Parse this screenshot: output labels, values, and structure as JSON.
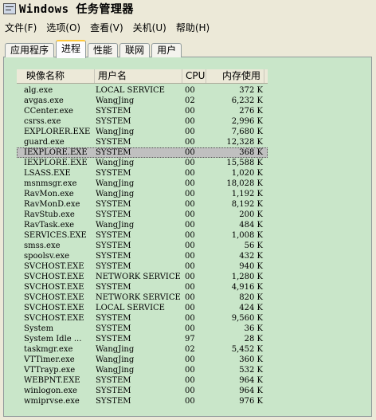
{
  "window": {
    "title": "Windows 任务管理器",
    "icon": "taskmgr-icon"
  },
  "menu": [
    "文件(F)",
    "选项(O)",
    "查看(V)",
    "关机(U)",
    "帮助(H)"
  ],
  "tabs": [
    {
      "label": "应用程序",
      "active": false
    },
    {
      "label": "进程",
      "active": true
    },
    {
      "label": "性能",
      "active": false
    },
    {
      "label": "联网",
      "active": false
    },
    {
      "label": "用户",
      "active": false
    }
  ],
  "columns": [
    "映像名称",
    "用户名",
    "CPU",
    "内存使用"
  ],
  "processes": [
    {
      "name": "alg.exe",
      "user": "LOCAL SERVICE",
      "cpu": "00",
      "mem": "372 K"
    },
    {
      "name": "avgas.exe",
      "user": "WangJing",
      "cpu": "02",
      "mem": "6,232 K"
    },
    {
      "name": "CCenter.exe",
      "user": "SYSTEM",
      "cpu": "00",
      "mem": "276 K"
    },
    {
      "name": "csrss.exe",
      "user": "SYSTEM",
      "cpu": "00",
      "mem": "2,996 K"
    },
    {
      "name": "EXPLORER.EXE",
      "user": "WangJing",
      "cpu": "00",
      "mem": "7,680 K"
    },
    {
      "name": "guard.exe",
      "user": "SYSTEM",
      "cpu": "00",
      "mem": "12,328 K"
    },
    {
      "name": "IEXPLORE.EXE",
      "user": "SYSTEM",
      "cpu": "00",
      "mem": "368 K",
      "selected": true
    },
    {
      "name": "IEXPLORE.EXE",
      "user": "WangJing",
      "cpu": "00",
      "mem": "15,588 K"
    },
    {
      "name": "LSASS.EXE",
      "user": "SYSTEM",
      "cpu": "00",
      "mem": "1,020 K"
    },
    {
      "name": "msnmsgr.exe",
      "user": "WangJing",
      "cpu": "00",
      "mem": "18,028 K"
    },
    {
      "name": "RavMon.exe",
      "user": "WangJing",
      "cpu": "00",
      "mem": "1,192 K"
    },
    {
      "name": "RavMonD.exe",
      "user": "SYSTEM",
      "cpu": "00",
      "mem": "8,192 K"
    },
    {
      "name": "RavStub.exe",
      "user": "SYSTEM",
      "cpu": "00",
      "mem": "200 K"
    },
    {
      "name": "RavTask.exe",
      "user": "WangJing",
      "cpu": "00",
      "mem": "484 K"
    },
    {
      "name": "SERVICES.EXE",
      "user": "SYSTEM",
      "cpu": "00",
      "mem": "1,008 K"
    },
    {
      "name": "smss.exe",
      "user": "SYSTEM",
      "cpu": "00",
      "mem": "56 K"
    },
    {
      "name": "spoolsv.exe",
      "user": "SYSTEM",
      "cpu": "00",
      "mem": "432 K"
    },
    {
      "name": "SVCHOST.EXE",
      "user": "SYSTEM",
      "cpu": "00",
      "mem": "940 K"
    },
    {
      "name": "SVCHOST.EXE",
      "user": "NETWORK SERVICE",
      "cpu": "00",
      "mem": "1,280 K"
    },
    {
      "name": "SVCHOST.EXE",
      "user": "SYSTEM",
      "cpu": "00",
      "mem": "4,916 K"
    },
    {
      "name": "SVCHOST.EXE",
      "user": "NETWORK SERVICE",
      "cpu": "00",
      "mem": "820 K"
    },
    {
      "name": "SVCHOST.EXE",
      "user": "LOCAL SERVICE",
      "cpu": "00",
      "mem": "424 K"
    },
    {
      "name": "SVCHOST.EXE",
      "user": "SYSTEM",
      "cpu": "00",
      "mem": "9,560 K"
    },
    {
      "name": "System",
      "user": "SYSTEM",
      "cpu": "00",
      "mem": "36 K"
    },
    {
      "name": "System Idle ...",
      "user": "SYSTEM",
      "cpu": "97",
      "mem": "28 K"
    },
    {
      "name": "taskmgr.exe",
      "user": "WangJing",
      "cpu": "02",
      "mem": "5,452 K"
    },
    {
      "name": "VTTimer.exe",
      "user": "WangJing",
      "cpu": "00",
      "mem": "360 K"
    },
    {
      "name": "VTTrayp.exe",
      "user": "WangJing",
      "cpu": "00",
      "mem": "532 K"
    },
    {
      "name": "WEBPNT.EXE",
      "user": "SYSTEM",
      "cpu": "00",
      "mem": "964 K"
    },
    {
      "name": "winlogon.exe",
      "user": "SYSTEM",
      "cpu": "00",
      "mem": "964 K"
    },
    {
      "name": "wmiprvse.exe",
      "user": "SYSTEM",
      "cpu": "00",
      "mem": "976 K"
    }
  ]
}
